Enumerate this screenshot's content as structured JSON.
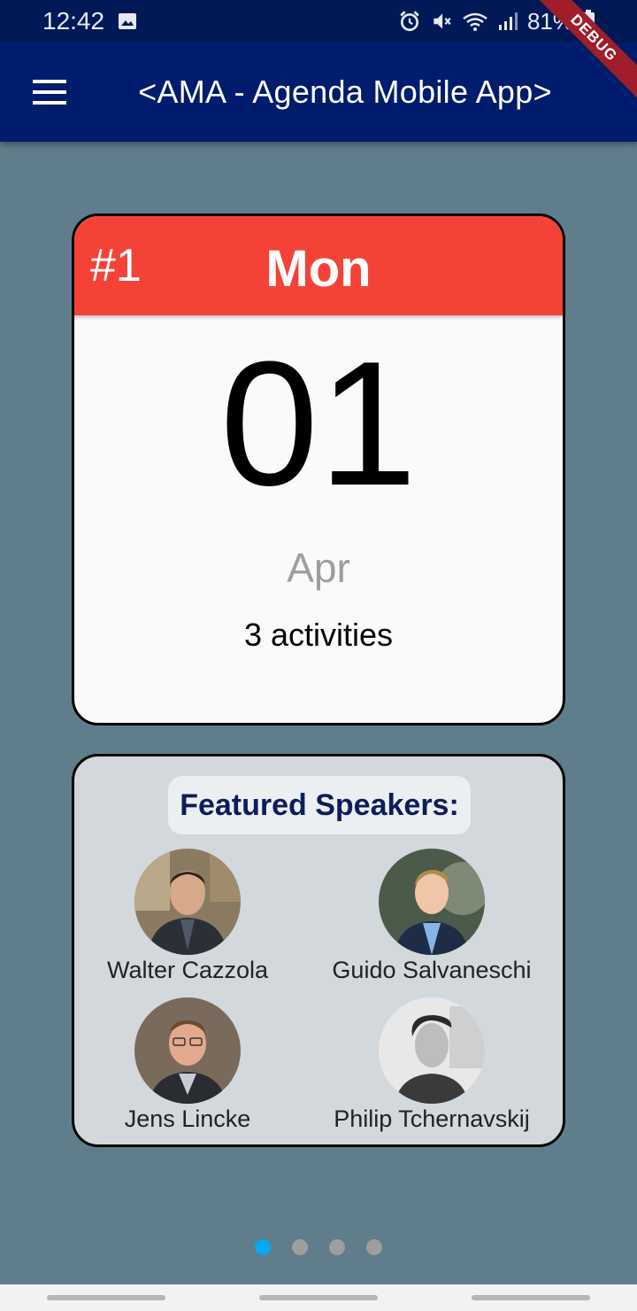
{
  "status_bar": {
    "time": "12:42",
    "battery": "81%",
    "icons": [
      "image-icon",
      "alarm-icon",
      "mute-icon",
      "wifi-icon",
      "signal-icon",
      "battery-icon"
    ]
  },
  "app_bar": {
    "title": "<AMA - Agenda Mobile App>",
    "menu_icon": "hamburger-menu-icon",
    "debug_label": "DEBUG"
  },
  "day_card": {
    "index": "#1",
    "weekday": "Mon",
    "day": "01",
    "month": "Apr",
    "activities": "3 activities",
    "header_color": "#f44336"
  },
  "featured": {
    "title": "Featured Speakers:",
    "speakers": [
      {
        "name": "Walter Cazzola"
      },
      {
        "name": "Guido Salvaneschi"
      },
      {
        "name": "Jens Lincke"
      },
      {
        "name": "Philip Tchernavskij"
      }
    ]
  },
  "pager": {
    "count": 4,
    "active_index": 0,
    "active_color": "#03a9f4"
  },
  "colors": {
    "background": "#607d8b",
    "app_bar": "#001c6c",
    "status_bar": "#011a57"
  }
}
